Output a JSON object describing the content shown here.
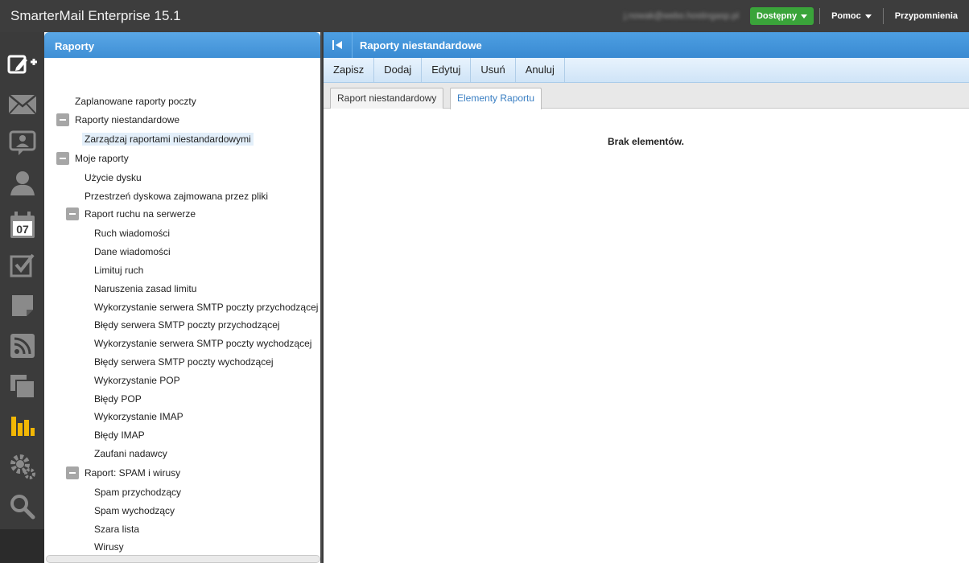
{
  "app": {
    "title": "SmarterMail Enterprise 15.1"
  },
  "topbar": {
    "user_email": "j.nowak@webo.hostingasp.pl",
    "status_label": "Dostępny",
    "help_label": "Pomoc",
    "reminders_label": "Przypomnienia"
  },
  "rail": {
    "items": [
      "compose-icon",
      "mail-icon",
      "contacts-icon",
      "user-icon",
      "calendar-icon",
      "tasks-icon",
      "notes-icon",
      "rss-icon",
      "files-icon",
      "reports-icon",
      "settings-icon",
      "search-icon"
    ],
    "calendar_day": "07",
    "active_color": "#f2b705"
  },
  "tree_panel": {
    "title": "Raporty",
    "nodes": {
      "scheduled": "Zaplanowane raporty poczty",
      "custom_reports": "Raporty niestandardowe",
      "manage_custom": "Zarządzaj raportami niestandardowymi",
      "my_reports": "Moje raporty",
      "disk_usage": "Użycie dysku",
      "disk_space_files": "Przestrzeń dyskowa zajmowana przez pliki",
      "server_traffic": "Raport ruchu na serwerze",
      "msg_traffic": "Ruch wiadomości",
      "msg_data": "Dane wiadomości",
      "throttle": "Limituj ruch",
      "limit_violations": "Naruszenia zasad limitu",
      "smtp_in_usage": "Wykorzystanie serwera SMTP poczty przychodzącej",
      "smtp_in_errors": "Błędy serwera SMTP poczty przychodzącej",
      "smtp_out_usage": "Wykorzystanie serwera SMTP poczty wychodzącej",
      "smtp_out_errors": "Błędy serwera SMTP poczty wychodzącej",
      "pop_usage": "Wykorzystanie POP",
      "pop_errors": "Błędy POP",
      "imap_usage": "Wykorzystanie IMAP",
      "imap_errors": "Błędy IMAP",
      "trusted_senders": "Zaufani nadawcy",
      "spam_virus": "Raport: SPAM i wirusy",
      "spam_in": "Spam przychodzący",
      "spam_out": "Spam wychodzący",
      "greylist": "Szara lista",
      "viruses": "Wirusy"
    }
  },
  "main": {
    "title": "Raporty niestandardowe",
    "toolbar": {
      "save": "Zapisz",
      "add": "Dodaj",
      "edit": "Edytuj",
      "delete": "Usuń",
      "cancel": "Anuluj"
    },
    "tabs": {
      "custom_report": "Raport niestandardowy",
      "report_elements": "Elementy Raportu"
    },
    "empty_message": "Brak elementów."
  },
  "colors": {
    "header_blue": "#3f8fd5",
    "status_green": "#3aa43a",
    "selected_bg": "#e3effa"
  }
}
